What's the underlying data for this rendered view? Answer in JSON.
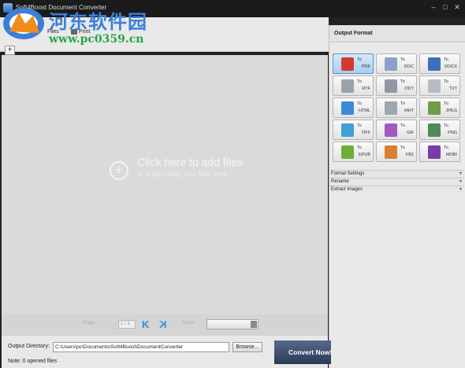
{
  "window": {
    "title": "Soft4Boost Document Converter",
    "minimize": "–",
    "maximize": "□",
    "close": "✕"
  },
  "watermark": {
    "name": "河东软件园",
    "url": "www.pc0359.cn"
  },
  "toolbar": {
    "files_label": "Files",
    "print_label": "Print",
    "add_label": "+"
  },
  "dropzone": {
    "title": "Click here to add files",
    "subtitle": "or drag'n'drop your files here",
    "plus": "+"
  },
  "pager": {
    "page_label": "Page",
    "page_value": "1 / 1",
    "first": "K",
    "last": "K",
    "zoom_label": "Zoom"
  },
  "output": {
    "label": "Output Directory:",
    "path": "C:\\Users\\pc\\Documents\\Soft4Boost\\DocumentConverter",
    "browse_label": "Browse..."
  },
  "status": {
    "note": "Note: 0 opened files"
  },
  "convert": {
    "label": "Convert Now!"
  },
  "panel": {
    "title": "Output Format",
    "to_label": "To",
    "formats": [
      {
        "name": "PDF",
        "color": "#d23a2e",
        "selected": true
      },
      {
        "name": "DOC",
        "color": "#8aa2c4"
      },
      {
        "name": "DOCX",
        "color": "#3d6fc1"
      },
      {
        "name": "RTF",
        "color": "#9aa3ad"
      },
      {
        "name": "ODT",
        "color": "#8f98a3"
      },
      {
        "name": "TXT",
        "color": "#b7bcc2"
      },
      {
        "name": "HTML",
        "color": "#3b8ad6"
      },
      {
        "name": "MHT",
        "color": "#9ea6b0"
      },
      {
        "name": "JPEG",
        "color": "#6f9c4d"
      },
      {
        "name": "TIFF",
        "color": "#3f9fd6"
      },
      {
        "name": "GIF",
        "color": "#a05ac0"
      },
      {
        "name": "PNG",
        "color": "#4f8a5a"
      },
      {
        "name": "EPUB",
        "color": "#6fae3b"
      },
      {
        "name": "FB2",
        "color": "#d7802f"
      },
      {
        "name": "MOBI",
        "color": "#7a3aa8"
      }
    ],
    "sections": [
      {
        "label": "Format Settings",
        "toggle": "▾"
      },
      {
        "label": "Rename",
        "toggle": "▾"
      },
      {
        "label": "Extract Images",
        "toggle": "▾"
      }
    ]
  }
}
